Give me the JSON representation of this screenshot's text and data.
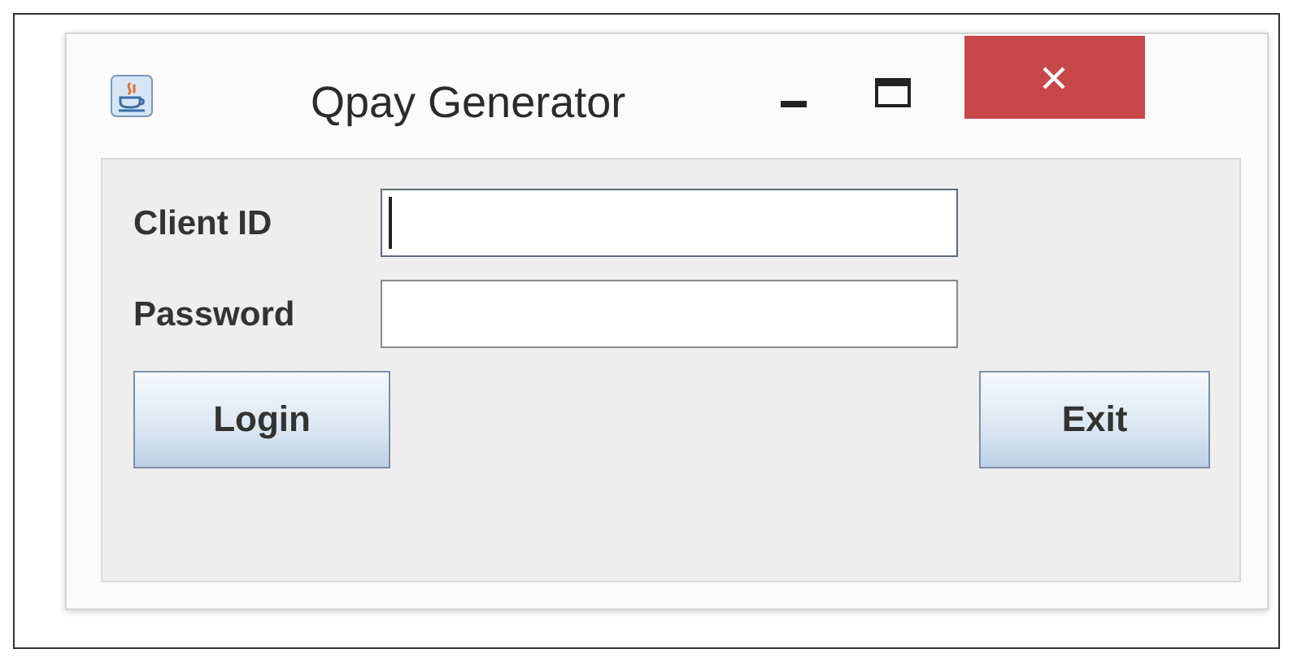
{
  "window": {
    "title": "Qpay Generator"
  },
  "fields": [
    {
      "label": "Client ID",
      "focused": true
    },
    {
      "label": "Password",
      "focused": false
    }
  ],
  "buttons": [
    {
      "label": "Login"
    },
    {
      "label": "Exit"
    }
  ]
}
